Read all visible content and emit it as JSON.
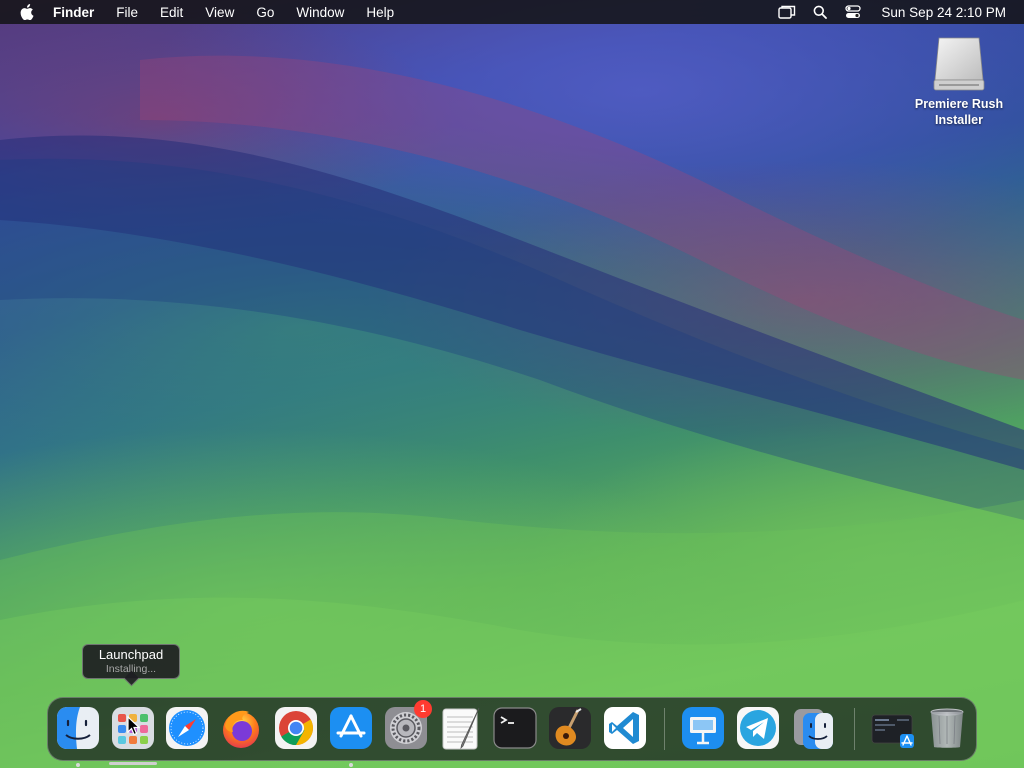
{
  "menubar": {
    "apple_icon": "apple-logo-icon",
    "app_name": "Finder",
    "menus": [
      "File",
      "Edit",
      "View",
      "Go",
      "Window",
      "Help"
    ],
    "status_icons": [
      "screen-mirroring-icon",
      "spotlight-search-icon",
      "control-center-icon"
    ],
    "clock": "Sun Sep 24  2:10 PM"
  },
  "desktop": {
    "icons": [
      {
        "label_line1": "Premiere Rush",
        "label_line2": "Installer",
        "icon": "disk-image-icon"
      }
    ]
  },
  "tooltip": {
    "title": "Launchpad",
    "subtitle": "Installing..."
  },
  "dock": {
    "apps": [
      {
        "name": "Finder",
        "icon": "finder-icon",
        "running": true
      },
      {
        "name": "Launchpad",
        "icon": "launchpad-icon",
        "progress": "installing"
      },
      {
        "name": "Safari",
        "icon": "safari-icon",
        "running": false
      },
      {
        "name": "Firefox",
        "icon": "firefox-icon",
        "running": false
      },
      {
        "name": "Google Chrome",
        "icon": "chrome-icon",
        "running": false
      },
      {
        "name": "App Store",
        "icon": "app-store-icon",
        "running": true
      },
      {
        "name": "System Settings",
        "icon": "system-settings-icon",
        "badge": "1",
        "running": false
      },
      {
        "name": "TextEdit",
        "icon": "textedit-icon",
        "running": false
      },
      {
        "name": "Terminal",
        "icon": "terminal-icon",
        "running": false
      },
      {
        "name": "GarageBand",
        "icon": "garageband-icon",
        "running": false
      },
      {
        "name": "Visual Studio Code",
        "icon": "vscode-icon",
        "running": false
      },
      {
        "name": "Keynote",
        "icon": "keynote-icon",
        "running": false
      },
      {
        "name": "Telegram",
        "icon": "telegram-icon",
        "running": false
      },
      {
        "name": "Migration Assistant",
        "icon": "migration-assistant-icon",
        "running": false
      },
      {
        "name": "Downloads Stack",
        "icon": "downloads-stack-icon",
        "running": false
      },
      {
        "name": "Trash",
        "icon": "trash-icon",
        "running": false
      }
    ]
  },
  "colors": {
    "menubar_bg": "#141418",
    "badge_red": "#ff3b30",
    "vscode_blue": "#1f8ad2",
    "safari_blue": "#1e90ff"
  }
}
